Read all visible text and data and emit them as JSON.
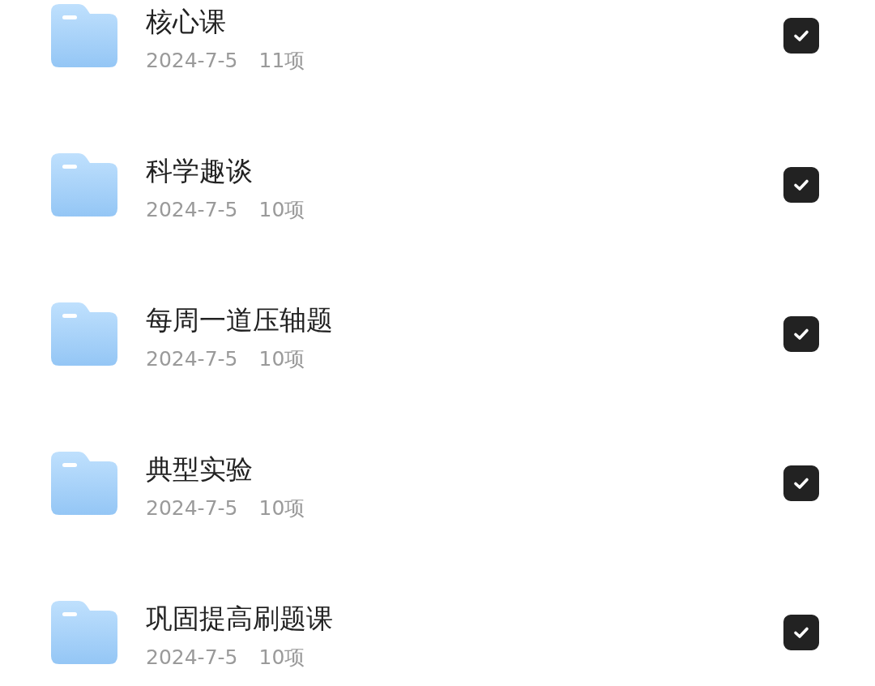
{
  "folders": [
    {
      "title": "核心课",
      "date": "2024-7-5",
      "count": "11项",
      "checked": true
    },
    {
      "title": "科学趣谈",
      "date": "2024-7-5",
      "count": "10项",
      "checked": true
    },
    {
      "title": "每周一道压轴题",
      "date": "2024-7-5",
      "count": "10项",
      "checked": true
    },
    {
      "title": "典型实验",
      "date": "2024-7-5",
      "count": "10项",
      "checked": true
    },
    {
      "title": "巩固提高刷题课",
      "date": "2024-7-5",
      "count": "10项",
      "checked": true
    }
  ]
}
